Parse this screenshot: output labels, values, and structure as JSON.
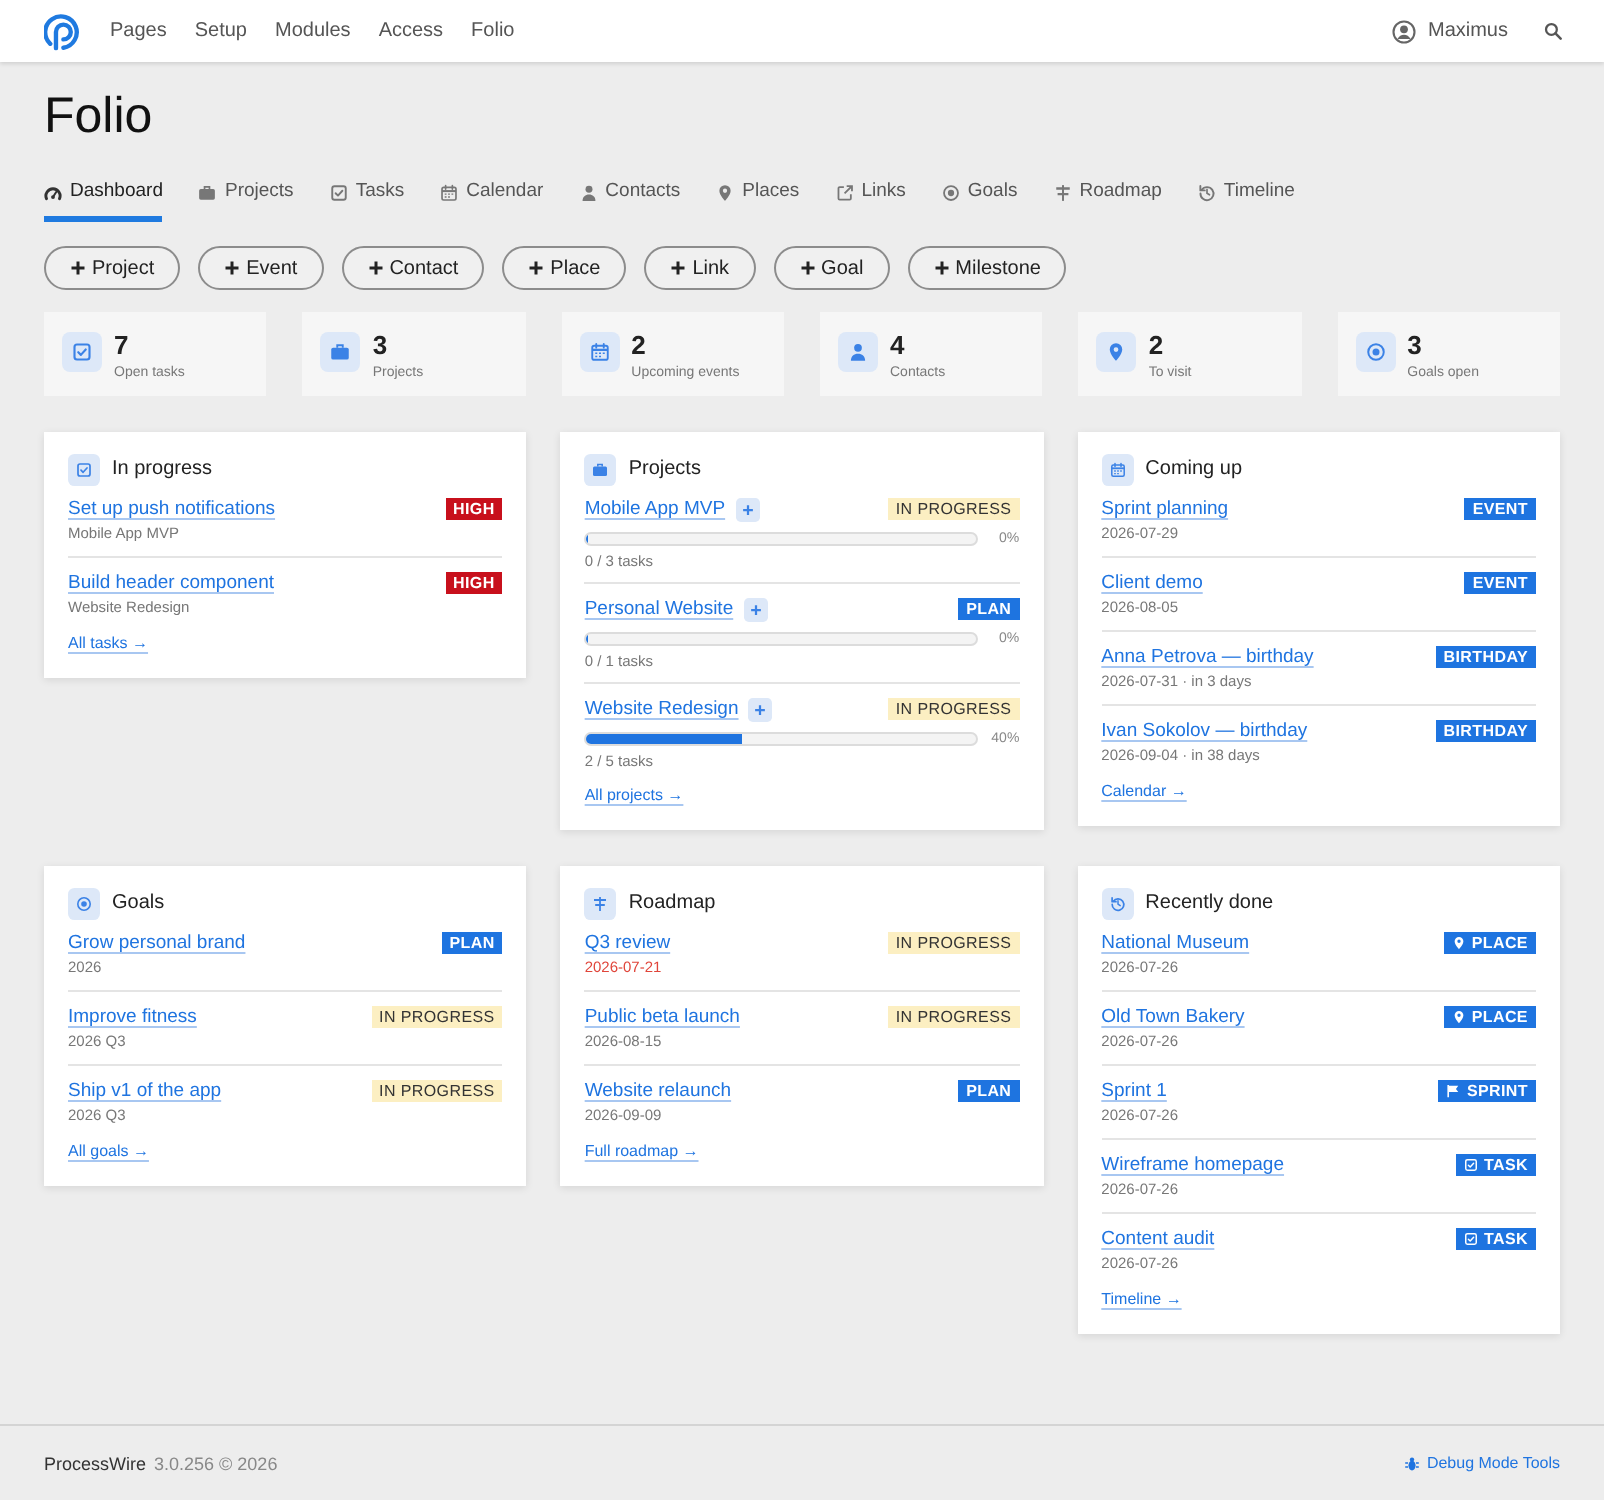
{
  "topbar": {
    "nav": [
      {
        "label": "Pages"
      },
      {
        "label": "Setup"
      },
      {
        "label": "Modules"
      },
      {
        "label": "Access"
      },
      {
        "label": "Folio"
      }
    ],
    "user": "Maximus"
  },
  "page_title": "Folio",
  "tabs": [
    {
      "label": "Dashboard",
      "selected": true
    },
    {
      "label": "Projects",
      "selected": false
    },
    {
      "label": "Tasks",
      "selected": false
    },
    {
      "label": "Calendar",
      "selected": false
    },
    {
      "label": "Contacts",
      "selected": false
    },
    {
      "label": "Places",
      "selected": false
    },
    {
      "label": "Links",
      "selected": false
    },
    {
      "label": "Goals",
      "selected": false
    },
    {
      "label": "Roadmap",
      "selected": false
    },
    {
      "label": "Timeline",
      "selected": false
    }
  ],
  "add_buttons": [
    "Project",
    "Event",
    "Contact",
    "Place",
    "Link",
    "Goal",
    "Milestone"
  ],
  "stats": [
    {
      "value": "7",
      "label": "Open tasks"
    },
    {
      "value": "3",
      "label": "Projects"
    },
    {
      "value": "2",
      "label": "Upcoming events"
    },
    {
      "value": "4",
      "label": "Contacts"
    },
    {
      "value": "2",
      "label": "To visit"
    },
    {
      "value": "3",
      "label": "Goals open"
    }
  ],
  "cards": [
    {
      "kind": "list",
      "title": "In progress",
      "items": [
        {
          "title": "Set up push notifications",
          "meta": "Mobile App MVP",
          "badge": {
            "text": "HIGH",
            "kind": "danger"
          }
        },
        {
          "title": "Build header component",
          "meta": "Website Redesign",
          "badge": {
            "text": "HIGH",
            "kind": "danger"
          }
        }
      ],
      "footer_link": "All tasks →"
    },
    {
      "kind": "projects",
      "title": "Projects",
      "items": [
        {
          "title": "Mobile App MVP",
          "badge": {
            "text": "IN PROGRESS",
            "kind": "warning"
          },
          "level": 0,
          "percent": "0%",
          "tasks": "0 / 3 tasks"
        },
        {
          "title": "Personal Website",
          "badge": {
            "text": "PLAN",
            "kind": "primary"
          },
          "level": 0,
          "percent": "0%",
          "tasks": "0 / 1 tasks"
        },
        {
          "title": "Website Redesign",
          "badge": {
            "text": "IN PROGRESS",
            "kind": "warning"
          },
          "level": 0.4,
          "percent": "40%",
          "tasks": "2 / 5 tasks"
        }
      ],
      "footer_link": "All projects →"
    },
    {
      "kind": "list",
      "title": "Coming up",
      "items": [
        {
          "title": "Sprint planning",
          "meta": "2026-07-29",
          "badge": {
            "text": "EVENT",
            "kind": "primary"
          }
        },
        {
          "title": "Client demo",
          "meta": "2026-08-05",
          "badge": {
            "text": "EVENT",
            "kind": "primary"
          }
        },
        {
          "title": "Anna Petrova — birthday",
          "meta": "2026-07-31 · in 3 days",
          "badge": {
            "text": "BIRTHDAY",
            "kind": "primary"
          }
        },
        {
          "title": "Ivan Sokolov — birthday",
          "meta": "2026-09-04 · in 38 days",
          "badge": {
            "text": "BIRTHDAY",
            "kind": "primary"
          }
        }
      ],
      "footer_link": "Calendar →"
    },
    {
      "kind": "list",
      "title": "Goals",
      "items": [
        {
          "title": "Grow personal brand",
          "meta": "2026",
          "badge": {
            "text": "PLAN",
            "kind": "primary"
          }
        },
        {
          "title": "Improve fitness",
          "meta": "2026 Q3",
          "badge": {
            "text": "IN PROGRESS",
            "kind": "warning"
          }
        },
        {
          "title": "Ship v1 of the app",
          "meta": "2026 Q3",
          "badge": {
            "text": "IN PROGRESS",
            "kind": "warning"
          }
        }
      ],
      "footer_link": "All goals →"
    },
    {
      "kind": "list",
      "title": "Roadmap",
      "items": [
        {
          "title": "Q3 review",
          "meta": "2026-07-21",
          "overdue": true,
          "badge": {
            "text": "IN PROGRESS",
            "kind": "warning"
          }
        },
        {
          "title": "Public beta launch",
          "meta": "2026-08-15",
          "overdue": false,
          "badge": {
            "text": "IN PROGRESS",
            "kind": "warning"
          }
        },
        {
          "title": "Website relaunch",
          "meta": "2026-09-09",
          "overdue": false,
          "badge": {
            "text": "PLAN",
            "kind": "primary"
          }
        }
      ],
      "footer_link": "Full roadmap →"
    },
    {
      "kind": "list",
      "title": "Recently done",
      "items": [
        {
          "title": "National Museum",
          "meta": "2026-07-26",
          "badge": {
            "text": "PLACE",
            "kind": "place"
          }
        },
        {
          "title": "Old Town Bakery",
          "meta": "2026-07-26",
          "badge": {
            "text": "PLACE",
            "kind": "place"
          }
        },
        {
          "title": "Sprint 1",
          "meta": "2026-07-26",
          "badge": {
            "text": "SPRINT",
            "kind": "sprint"
          }
        },
        {
          "title": "Wireframe homepage",
          "meta": "2026-07-26",
          "badge": {
            "text": "TASK",
            "kind": "task"
          }
        },
        {
          "title": "Content audit",
          "meta": "2026-07-26",
          "badge": {
            "text": "TASK",
            "kind": "task"
          }
        }
      ],
      "footer_link": "Timeline →"
    }
  ],
  "footer": {
    "brand": "ProcessWire",
    "version": "3.0.256 © 2026",
    "debug_link": "Debug Mode Tools"
  }
}
